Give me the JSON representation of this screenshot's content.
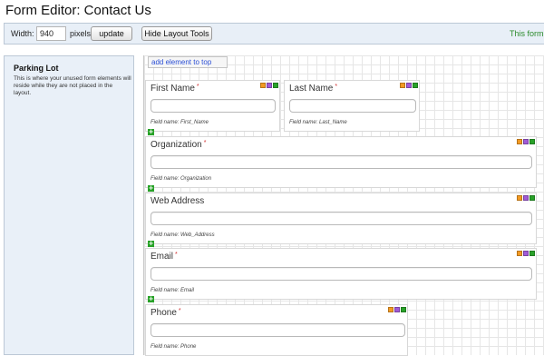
{
  "page": {
    "title": "Form Editor: Contact Us"
  },
  "toolbar": {
    "width_label": "Width:",
    "width_value": "940",
    "pixels_label": "pixels",
    "update_label": "update",
    "hide_layout_label": "Hide Layout Tools",
    "status_text": "This form i"
  },
  "parking_lot": {
    "title": "Parking Lot",
    "description": "This is where your unused form elements will reside while they are not placed in the layout."
  },
  "layout": {
    "add_top_label": "add element to top",
    "fields": [
      {
        "label": "First Name",
        "required": "*",
        "field_name": "Field name: First_Name"
      },
      {
        "label": "Last Name",
        "required": "*",
        "field_name": "Field name: Last_Name"
      },
      {
        "label": "Organization",
        "required": "*",
        "field_name": "Field name: Organization"
      },
      {
        "label": "Web Address",
        "required": "",
        "field_name": "Field name: Web_Address"
      },
      {
        "label": "Email",
        "required": "*",
        "field_name": "Field name: Email"
      },
      {
        "label": "Phone",
        "required": "*",
        "field_name": "Field name: Phone"
      }
    ]
  },
  "icons": {
    "add": "plus-icon",
    "tool_colors": {
      "orange": "#f39a22",
      "purple": "#a05ad6",
      "green": "#28a228"
    }
  },
  "colors": {
    "accent_link": "#2b4fd6",
    "status_green": "#2a8a2a",
    "required_red": "#d23030"
  }
}
